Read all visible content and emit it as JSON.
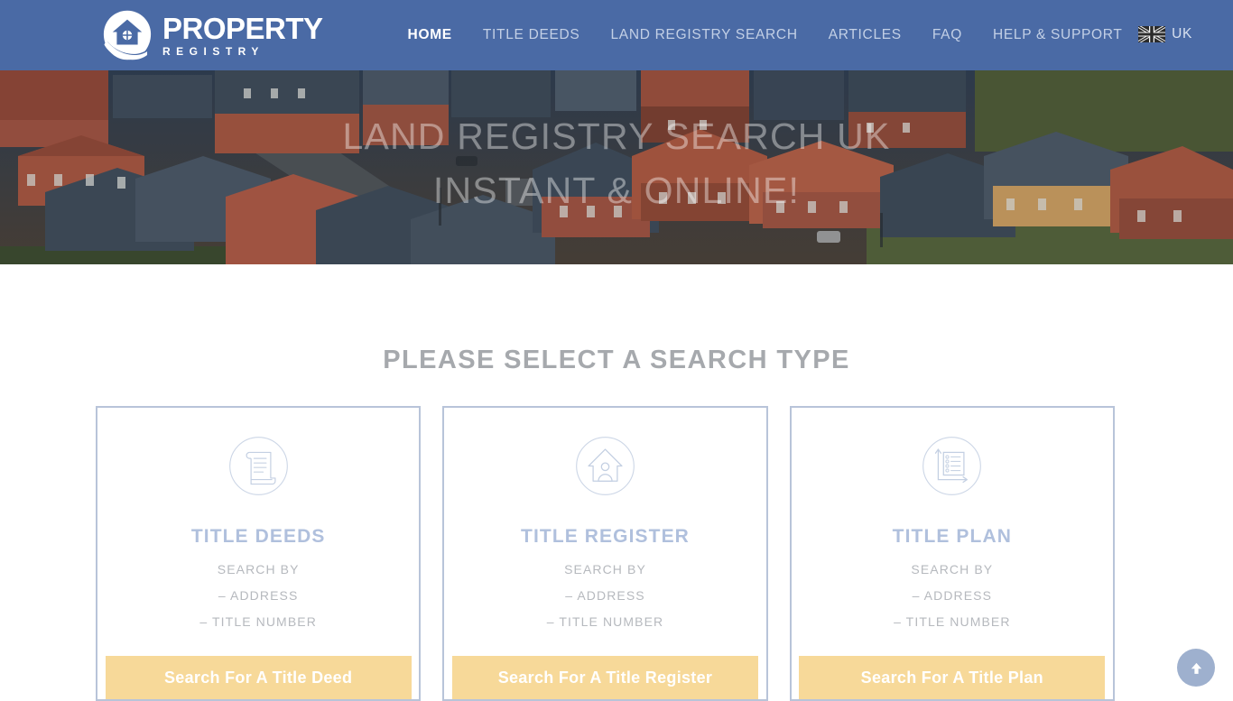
{
  "header": {
    "logo": {
      "icon": "house-in-circle-logo-icon",
      "line1": "PROPERTY",
      "line2": "REGISTRY"
    },
    "nav": [
      {
        "label": "HOME",
        "active": true
      },
      {
        "label": "TITLE DEEDS",
        "active": false
      },
      {
        "label": "LAND REGISTRY SEARCH",
        "active": false
      },
      {
        "label": "ARTICLES",
        "active": false
      },
      {
        "label": "FAQ",
        "active": false
      },
      {
        "label": "HELP & SUPPORT",
        "active": false
      }
    ],
    "language": {
      "flag_icon": "uk-flag-icon",
      "label": "UK"
    },
    "background_color": "#4a6aa5"
  },
  "hero": {
    "title_line1": "LAND REGISTRY SEARCH UK",
    "title_line2": "INSTANT & ONLINE!",
    "image_description": "aerial-view-of-uk-housing-estate"
  },
  "main": {
    "section_title": "PLEASE SELECT A SEARCH TYPE",
    "cards": [
      {
        "icon": "scroll-document-icon",
        "title": "TITLE DEEDS",
        "search_by_label": "SEARCH BY",
        "option1": "– ADDRESS",
        "option2": "– TITLE NUMBER",
        "button_label": "Search For A Title Deed"
      },
      {
        "icon": "house-with-person-icon",
        "title": "TITLE REGISTER",
        "search_by_label": "SEARCH BY",
        "option1": "– ADDRESS",
        "option2": "– TITLE NUMBER",
        "button_label": "Search For A Title Register"
      },
      {
        "icon": "plan-checklist-icon",
        "title": "TITLE PLAN",
        "search_by_label": "SEARCH BY",
        "option1": "– ADDRESS",
        "option2": "– TITLE NUMBER",
        "button_label": "Search For A Title Plan"
      }
    ]
  },
  "scroll_top": {
    "icon": "arrow-up-icon",
    "color": "#9eb0ce"
  },
  "colors": {
    "header_blue": "#4a6aa5",
    "button_yellow": "#f7d999",
    "card_border": "#b8c4d9",
    "card_title": "#b0c0dd",
    "section_title": "#a6a9ad"
  }
}
